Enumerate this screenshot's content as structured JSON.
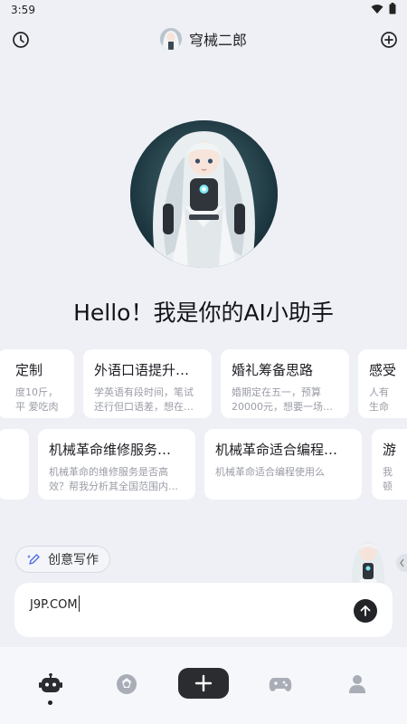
{
  "status": {
    "time": "3:59"
  },
  "header": {
    "title": "穹械二郎"
  },
  "greeting": {
    "text": "Hello！我是你的AI小助手"
  },
  "cards_row1": [
    {
      "title": "定制",
      "desc": "度10斤，平 爱吃肉 ..."
    },
    {
      "title": "外语口语提升…",
      "desc": "学英语有段时间，笔试还行但口语差，想在…"
    },
    {
      "title": "婚礼筹备思路",
      "desc": "婚期定在五一，预算20000元，想要一场…"
    },
    {
      "title": "感受",
      "desc": "人有 生命"
    }
  ],
  "cards_row2": [
    {
      "title": "机械革命维修服务…",
      "desc": "机械革命的维修服务是否高效？帮我分析其全国范围内…"
    },
    {
      "title": "机械革命适合编程…",
      "desc": "机械革命适合编程使用么"
    },
    {
      "title": "游",
      "desc": "我 顿"
    }
  ],
  "chip": {
    "label": "创意写作"
  },
  "composer": {
    "value": "J9P.COM"
  },
  "colors": {
    "background": "#eef0f6",
    "card": "#ffffff",
    "accent_dark": "#2b2c30"
  }
}
